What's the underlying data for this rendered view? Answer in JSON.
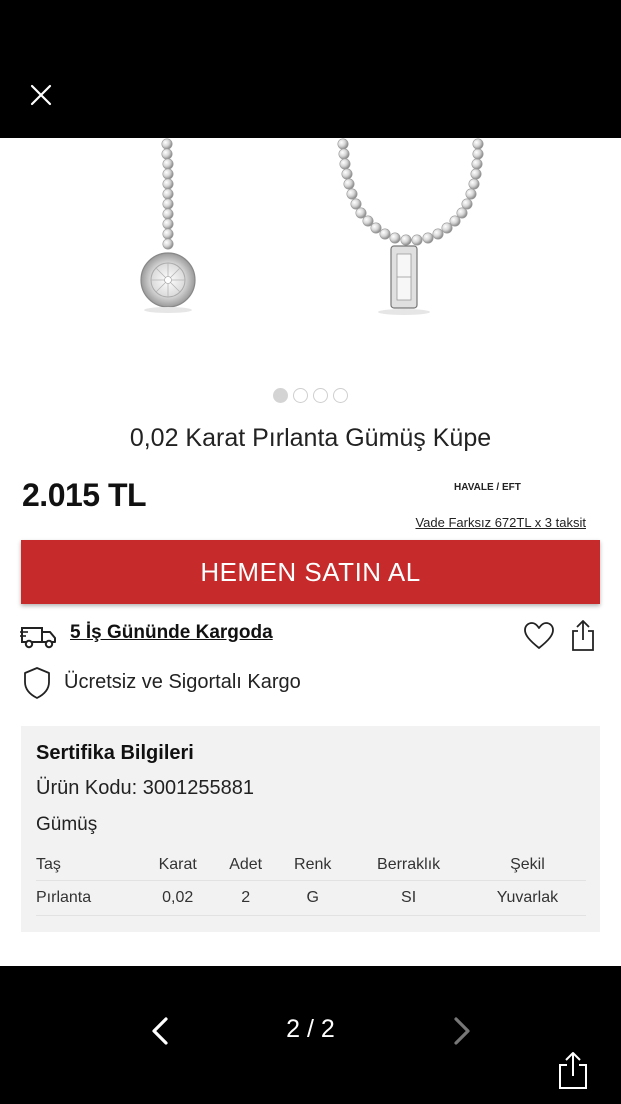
{
  "viewer": {
    "close_icon": "close-icon",
    "pager_text": "2 / 2",
    "prev_icon": "chevron-left-icon",
    "next_icon": "chevron-right-icon",
    "share_icon": "share-icon"
  },
  "carousel": {
    "slide_count": 4,
    "active_index": 0
  },
  "product": {
    "title": "0,02 Karat Pırlanta Gümüş Küpe",
    "price": "2.015 TL",
    "havale": "HAVALE / EFT",
    "installment": "Vade Farksız 672TL x 3 taksit",
    "buy_label": "HEMEN SATIN AL",
    "shipping_link": "5 İş Gününde Kargoda",
    "free_shipping": "Ücretsiz ve Sigortalı Kargo"
  },
  "certificate": {
    "title": "Sertifika Bilgileri",
    "code": "Ürün Kodu: 3001255881",
    "metal": "Gümüş",
    "columns": [
      "Taş",
      "Karat",
      "Adet",
      "Renk",
      "Berraklık",
      "Şekil"
    ],
    "rows": [
      [
        "Pırlanta",
        "0,02",
        "2",
        "G",
        "SI",
        "Yuvarlak"
      ]
    ]
  },
  "colors": {
    "accent": "#c62a2a",
    "background": "#000000",
    "panel": "#f2f2f2"
  }
}
